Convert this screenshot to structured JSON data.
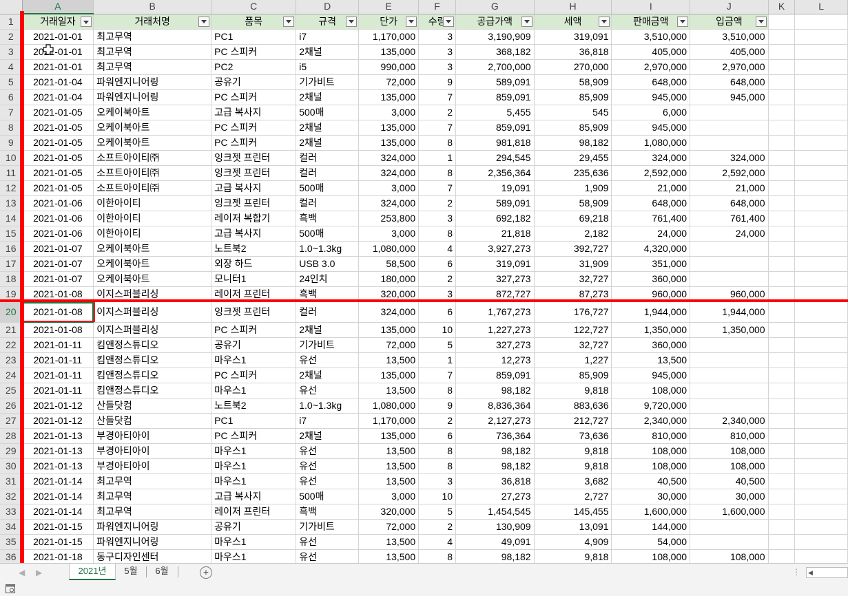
{
  "column_letters": [
    "A",
    "B",
    "C",
    "D",
    "E",
    "F",
    "G",
    "H",
    "I",
    "J",
    "K",
    "L"
  ],
  "headers": [
    "거래일자",
    "거래처명",
    "품목",
    "규격",
    "단가",
    "수량",
    "공급가액",
    "세액",
    "판매금액",
    "입금액"
  ],
  "rows": [
    [
      "2021-01-01",
      "최고무역",
      "PC1",
      "i7",
      "1,170,000",
      "3",
      "3,190,909",
      "319,091",
      "3,510,000",
      "3,510,000"
    ],
    [
      "2021-01-01",
      "최고무역",
      "PC 스피커",
      "2채널",
      "135,000",
      "3",
      "368,182",
      "36,818",
      "405,000",
      "405,000"
    ],
    [
      "2021-01-01",
      "최고무역",
      "PC2",
      "i5",
      "990,000",
      "3",
      "2,700,000",
      "270,000",
      "2,970,000",
      "2,970,000"
    ],
    [
      "2021-01-04",
      "파워엔지니어링",
      "공유기",
      "기가비트",
      "72,000",
      "9",
      "589,091",
      "58,909",
      "648,000",
      "648,000"
    ],
    [
      "2021-01-04",
      "파워엔지니어링",
      "PC 스피커",
      "2채널",
      "135,000",
      "7",
      "859,091",
      "85,909",
      "945,000",
      "945,000"
    ],
    [
      "2021-01-05",
      "오케이북아트",
      "고급 복사지",
      "500매",
      "3,000",
      "2",
      "5,455",
      "545",
      "6,000",
      ""
    ],
    [
      "2021-01-05",
      "오케이북아트",
      "PC 스피커",
      "2채널",
      "135,000",
      "7",
      "859,091",
      "85,909",
      "945,000",
      ""
    ],
    [
      "2021-01-05",
      "오케이북아트",
      "PC 스피커",
      "2채널",
      "135,000",
      "8",
      "981,818",
      "98,182",
      "1,080,000",
      ""
    ],
    [
      "2021-01-05",
      "소프트아이티㈜",
      "잉크젯 프린터",
      "컬러",
      "324,000",
      "1",
      "294,545",
      "29,455",
      "324,000",
      "324,000"
    ],
    [
      "2021-01-05",
      "소프트아이티㈜",
      "잉크젯 프린터",
      "컬러",
      "324,000",
      "8",
      "2,356,364",
      "235,636",
      "2,592,000",
      "2,592,000"
    ],
    [
      "2021-01-05",
      "소프트아이티㈜",
      "고급 복사지",
      "500매",
      "3,000",
      "7",
      "19,091",
      "1,909",
      "21,000",
      "21,000"
    ],
    [
      "2021-01-06",
      "이한아이티",
      "잉크젯 프린터",
      "컬러",
      "324,000",
      "2",
      "589,091",
      "58,909",
      "648,000",
      "648,000"
    ],
    [
      "2021-01-06",
      "이한아이티",
      "레이저 복합기",
      "흑백",
      "253,800",
      "3",
      "692,182",
      "69,218",
      "761,400",
      "761,400"
    ],
    [
      "2021-01-06",
      "이한아이티",
      "고급 복사지",
      "500매",
      "3,000",
      "8",
      "21,818",
      "2,182",
      "24,000",
      "24,000"
    ],
    [
      "2021-01-07",
      "오케이북아트",
      "노트북2",
      "1.0~1.3kg",
      "1,080,000",
      "4",
      "3,927,273",
      "392,727",
      "4,320,000",
      ""
    ],
    [
      "2021-01-07",
      "오케이북아트",
      "외장 하드",
      "USB 3.0",
      "58,500",
      "6",
      "319,091",
      "31,909",
      "351,000",
      ""
    ],
    [
      "2021-01-07",
      "오케이북아트",
      "모니터1",
      "24인치",
      "180,000",
      "2",
      "327,273",
      "32,727",
      "360,000",
      ""
    ],
    [
      "2021-01-08",
      "이지스퍼블리싱",
      "레이저 프린터",
      "흑백",
      "320,000",
      "3",
      "872,727",
      "87,273",
      "960,000",
      "960,000"
    ],
    [
      "2021-01-08",
      "이지스퍼블리싱",
      "잉크젯 프린터",
      "컬러",
      "324,000",
      "6",
      "1,767,273",
      "176,727",
      "1,944,000",
      "1,944,000"
    ],
    [
      "2021-01-08",
      "이지스퍼블리싱",
      "PC 스피커",
      "2채널",
      "135,000",
      "10",
      "1,227,273",
      "122,727",
      "1,350,000",
      "1,350,000"
    ],
    [
      "2021-01-11",
      "킴앤정스튜디오",
      "공유기",
      "기가비트",
      "72,000",
      "5",
      "327,273",
      "32,727",
      "360,000",
      ""
    ],
    [
      "2021-01-11",
      "킴앤정스튜디오",
      "마우스1",
      "유선",
      "13,500",
      "1",
      "12,273",
      "1,227",
      "13,500",
      ""
    ],
    [
      "2021-01-11",
      "킴앤정스튜디오",
      "PC 스피커",
      "2채널",
      "135,000",
      "7",
      "859,091",
      "85,909",
      "945,000",
      ""
    ],
    [
      "2021-01-11",
      "킴앤정스튜디오",
      "마우스1",
      "유선",
      "13,500",
      "8",
      "98,182",
      "9,818",
      "108,000",
      ""
    ],
    [
      "2021-01-12",
      "산들닷컴",
      "노트북2",
      "1.0~1.3kg",
      "1,080,000",
      "9",
      "8,836,364",
      "883,636",
      "9,720,000",
      ""
    ],
    [
      "2021-01-12",
      "산들닷컴",
      "PC1",
      "i7",
      "1,170,000",
      "2",
      "2,127,273",
      "212,727",
      "2,340,000",
      "2,340,000"
    ],
    [
      "2021-01-13",
      "부경아티아이",
      "PC 스피커",
      "2채널",
      "135,000",
      "6",
      "736,364",
      "73,636",
      "810,000",
      "810,000"
    ],
    [
      "2021-01-13",
      "부경아티아이",
      "마우스1",
      "유선",
      "13,500",
      "8",
      "98,182",
      "9,818",
      "108,000",
      "108,000"
    ],
    [
      "2021-01-13",
      "부경아티아이",
      "마우스1",
      "유선",
      "13,500",
      "8",
      "98,182",
      "9,818",
      "108,000",
      "108,000"
    ],
    [
      "2021-01-14",
      "최고무역",
      "마우스1",
      "유선",
      "13,500",
      "3",
      "36,818",
      "3,682",
      "40,500",
      "40,500"
    ],
    [
      "2021-01-14",
      "최고무역",
      "고급 복사지",
      "500매",
      "3,000",
      "10",
      "27,273",
      "2,727",
      "30,000",
      "30,000"
    ],
    [
      "2021-01-14",
      "최고무역",
      "레이저 프린터",
      "흑백",
      "320,000",
      "5",
      "1,454,545",
      "145,455",
      "1,600,000",
      "1,600,000"
    ],
    [
      "2021-01-15",
      "파워엔지니어링",
      "공유기",
      "기가비트",
      "72,000",
      "2",
      "130,909",
      "13,091",
      "144,000",
      ""
    ],
    [
      "2021-01-15",
      "파워엔지니어링",
      "마우스1",
      "유선",
      "13,500",
      "4",
      "49,091",
      "4,909",
      "54,000",
      ""
    ],
    [
      "2021-01-18",
      "동구디자인센터",
      "마우스1",
      "유선",
      "13,500",
      "8",
      "98,182",
      "9,818",
      "108,000",
      "108,000"
    ]
  ],
  "active_cell": {
    "row": 20,
    "col": "A"
  },
  "sheet_tabs": [
    "2021년",
    "5월",
    "6월"
  ],
  "active_tab": "2021년",
  "add_sheet_glyph": "+",
  "colors": {
    "accent": "#217346",
    "header_fill": "#d9ead3",
    "annotation_red": "#ff0000"
  },
  "icons": {
    "filter": "filter-dropdown-icon",
    "add_sheet": "plus-circle-icon",
    "status": "macro-record-icon",
    "cursor": "move-cursor-icon"
  }
}
